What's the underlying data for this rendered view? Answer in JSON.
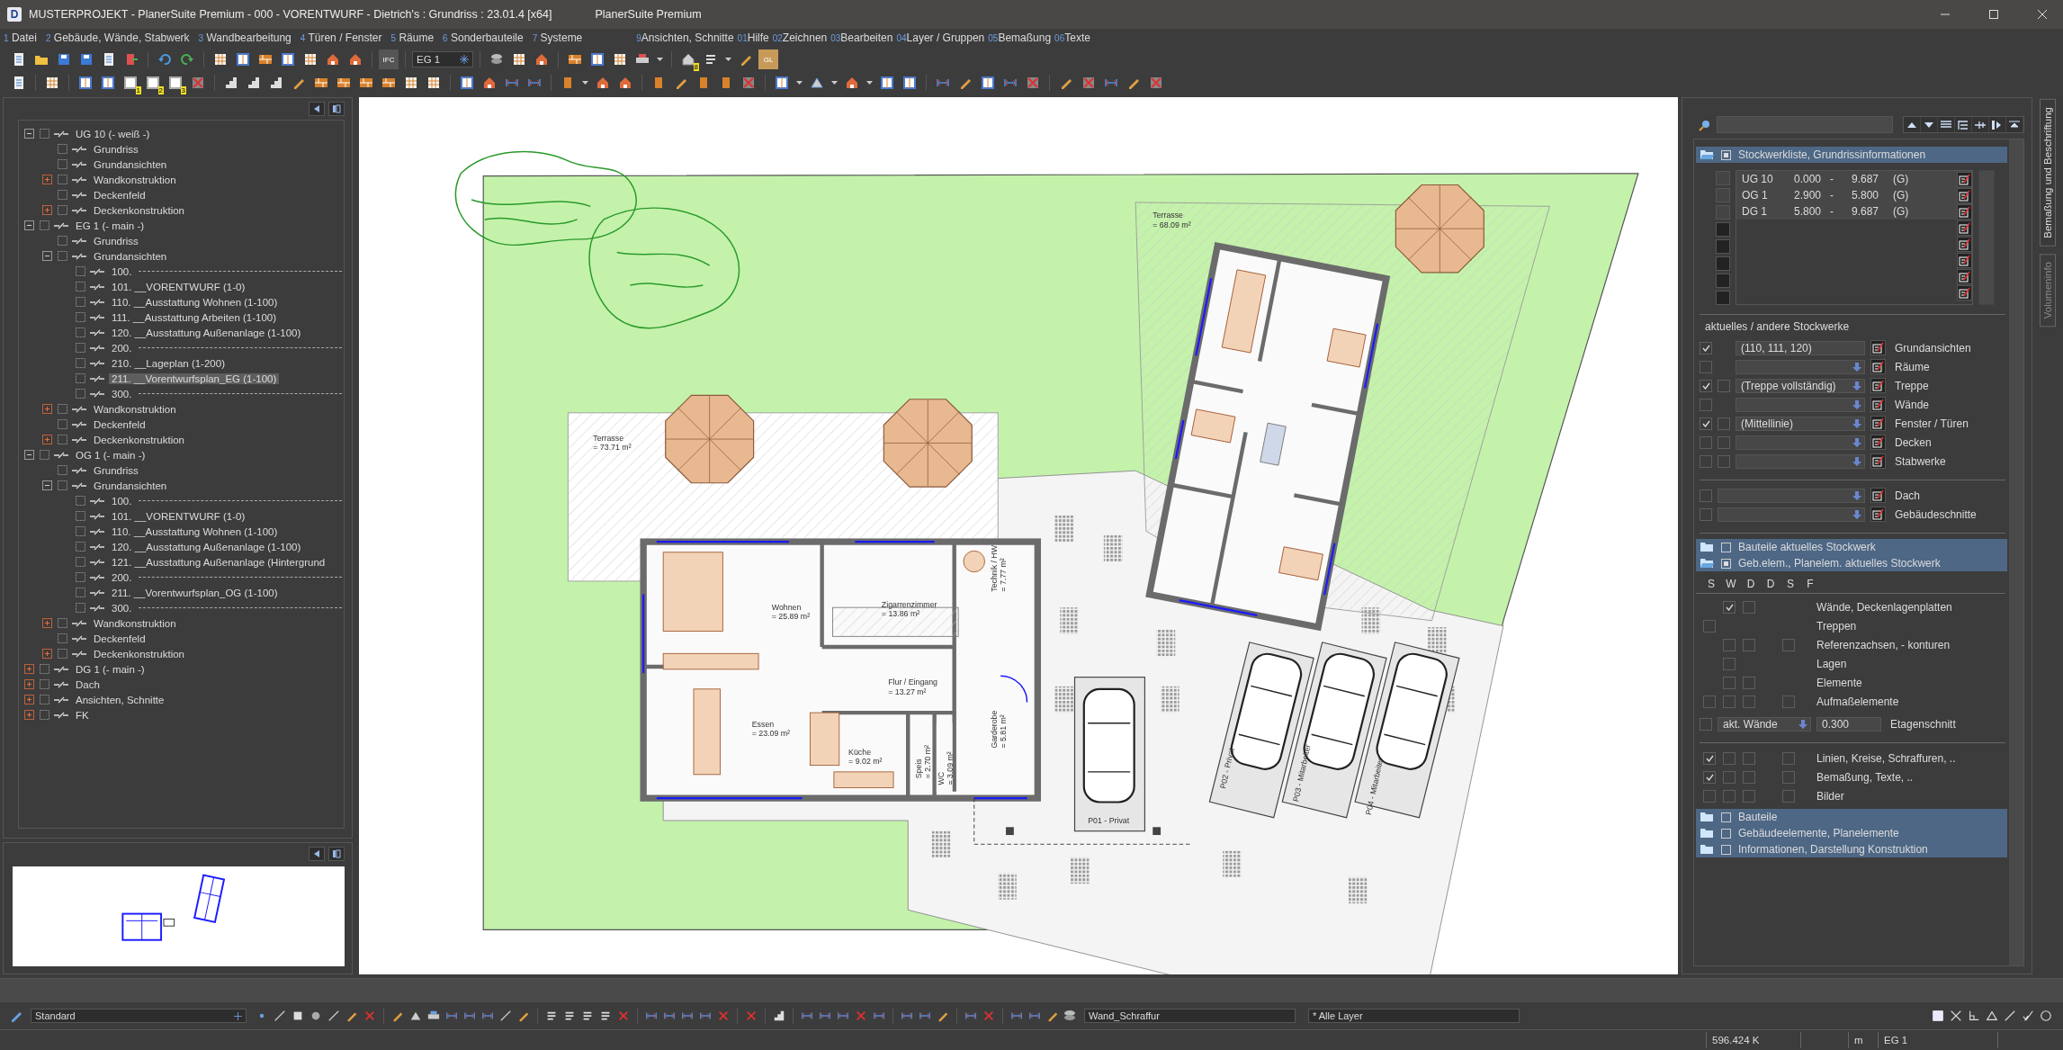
{
  "window": {
    "logo_letter": "D",
    "title": "MUSTERPROJEKT - PlanerSuite Premium - 000 - VORENTWURF - Dietrich's : Grundriss : 23.01.4 [x64]",
    "app_name": "PlanerSuite Premium"
  },
  "menu_left": [
    {
      "num": "1",
      "label": "Datei"
    },
    {
      "num": "2",
      "label": "Gebäude, Wände, Stabwerk"
    },
    {
      "num": "3",
      "label": "Wandbearbeitung"
    },
    {
      "num": "4",
      "label": "Türen / Fenster"
    },
    {
      "num": "5",
      "label": "Räume"
    },
    {
      "num": "6",
      "label": "Sonderbauteile"
    },
    {
      "num": "7",
      "label": "Systeme"
    }
  ],
  "menu_right": [
    {
      "num": "9",
      "label": "Ansichten, Schnitte"
    },
    {
      "num": "01",
      "label": "Hilfe"
    },
    {
      "num": "02",
      "label": "Zeichnen"
    },
    {
      "num": "03",
      "label": "Bearbeiten"
    },
    {
      "num": "04",
      "label": "Layer / Gruppen"
    },
    {
      "num": "05",
      "label": "Bemaßung"
    },
    {
      "num": "06",
      "label": "Texte"
    }
  ],
  "toolbars": {
    "floor_select": "EG 1",
    "ifc_label": "IFC",
    "gl_label": "GL",
    "badge": "8",
    "tool_badges": [
      "1",
      "2",
      "3"
    ]
  },
  "layer_tree": [
    {
      "label": "UG 10 (- weiß -)",
      "kind": "group",
      "expanded": true,
      "selected": false,
      "children": [
        {
          "label": "Grundriss",
          "kind": "leaf",
          "selected": false
        },
        {
          "label": "Grundansichten",
          "kind": "leaf",
          "selected": false
        },
        {
          "label": "Wandkonstruktion",
          "kind": "group",
          "expanded": false,
          "selected": false
        },
        {
          "label": "Deckenfeld",
          "kind": "leaf",
          "selected": false
        },
        {
          "label": "Deckenkonstruktion",
          "kind": "group",
          "expanded": false,
          "selected": false
        }
      ]
    },
    {
      "label": "EG 1 (- main -)",
      "kind": "group",
      "expanded": true,
      "selected": false,
      "children": [
        {
          "label": "Grundriss",
          "kind": "leaf",
          "selected": false
        },
        {
          "label": "Grundansichten",
          "kind": "group",
          "expanded": true,
          "selected": false,
          "children": [
            {
              "label": "100.",
              "kind": "separator",
              "selected": false
            },
            {
              "label": "101. __VORENTWURF (1-0)",
              "kind": "leaf",
              "selected": false
            },
            {
              "label": "110. __Ausstattung Wohnen (1-100)",
              "kind": "leaf",
              "selected": false
            },
            {
              "label": "111. __Ausstattung Arbeiten (1-100)",
              "kind": "leaf",
              "selected": false
            },
            {
              "label": "120. __Ausstattung Außenanlage (1-100)",
              "kind": "leaf",
              "selected": false
            },
            {
              "label": "200.",
              "kind": "separator",
              "selected": false
            },
            {
              "label": "210. __Lageplan (1-200)",
              "kind": "leaf",
              "selected": false
            },
            {
              "label": "211. __Vorentwurfsplan_EG (1-100)",
              "kind": "leaf",
              "selected": true
            },
            {
              "label": "300.",
              "kind": "separator",
              "selected": false
            }
          ]
        },
        {
          "label": "Wandkonstruktion",
          "kind": "group",
          "expanded": false,
          "selected": false
        },
        {
          "label": "Deckenfeld",
          "kind": "leaf",
          "selected": false
        },
        {
          "label": "Deckenkonstruktion",
          "kind": "group",
          "expanded": false,
          "selected": false
        }
      ]
    },
    {
      "label": "OG 1 (- main -)",
      "kind": "group",
      "expanded": true,
      "selected": false,
      "children": [
        {
          "label": "Grundriss",
          "kind": "leaf",
          "selected": false
        },
        {
          "label": "Grundansichten",
          "kind": "group",
          "expanded": true,
          "selected": false,
          "children": [
            {
              "label": "100.",
              "kind": "separator",
              "selected": false
            },
            {
              "label": "101. __VORENTWURF (1-0)",
              "kind": "leaf",
              "selected": false
            },
            {
              "label": "110. __Ausstattung Wohnen (1-100)",
              "kind": "leaf",
              "selected": false
            },
            {
              "label": "120. __Ausstattung Außenanlage (1-100)",
              "kind": "leaf",
              "selected": false
            },
            {
              "label": "121. __Ausstattung Außenanlage (Hintergrund",
              "kind": "leaf",
              "selected": false
            },
            {
              "label": "200.",
              "kind": "separator",
              "selected": false
            },
            {
              "label": "211. __Vorentwurfsplan_OG (1-100)",
              "kind": "leaf",
              "selected": false
            },
            {
              "label": "300.",
              "kind": "separator",
              "selected": false
            }
          ]
        },
        {
          "label": "Wandkonstruktion",
          "kind": "group",
          "expanded": false,
          "selected": false
        },
        {
          "label": "Deckenfeld",
          "kind": "leaf",
          "selected": false
        },
        {
          "label": "Deckenkonstruktion",
          "kind": "group",
          "expanded": false,
          "selected": false
        }
      ]
    },
    {
      "label": "DG 1 (- main -)",
      "kind": "group",
      "expanded": false,
      "selected": false
    },
    {
      "label": "Dach",
      "kind": "group",
      "expanded": false,
      "selected": false
    },
    {
      "label": "Ansichten, Schnitte",
      "kind": "group",
      "expanded": false,
      "selected": false
    },
    {
      "label": "FK",
      "kind": "group",
      "expanded": false,
      "selected": false
    }
  ],
  "plan": {
    "labels": [
      {
        "name": "Terrasse",
        "area": "= 73.71 m²"
      },
      {
        "name": "Wohnen",
        "area": "= 25.89 m²"
      },
      {
        "name": "Zigarrenzimmer",
        "area": "= 13.86 m²"
      },
      {
        "name": "Technik / HW",
        "area": "= 7.77 m²"
      },
      {
        "name": "Flur / Eingang",
        "area": "= 13.27 m²"
      },
      {
        "name": "Essen",
        "area": "= 23.09 m²"
      },
      {
        "name": "Küche",
        "area": "= 9.02 m²"
      },
      {
        "name": "Speis",
        "area": "= 2.70 m²"
      },
      {
        "name": "WC",
        "area": "= 3.09 m²"
      },
      {
        "name": "Garderobe",
        "area": "= 5.81 m²"
      },
      {
        "name": "Terrasse",
        "area": "= 68.09 m²"
      }
    ],
    "parking": [
      "P01 - Privat",
      "P02 - Privat",
      "P03 - Mitarbeiter",
      "P04 - Mitarbeiter"
    ]
  },
  "floor_list": {
    "label": "Stockwerkliste, Grundrissinformationen",
    "open": true,
    "checked": true,
    "floors": [
      {
        "name": "UG 10",
        "from": "0.000",
        "dash": "-",
        "to": "9.687",
        "flag": "(G)",
        "checked": false
      },
      {
        "name": "OG 1",
        "from": "2.900",
        "dash": "-",
        "to": "5.800",
        "flag": "(G)",
        "checked": false
      },
      {
        "name": "DG 1",
        "from": "5.800",
        "dash": "-",
        "to": "9.687",
        "flag": "(G)",
        "checked": false
      }
    ]
  },
  "other_floors": {
    "title": "aktuelles / andere Stockwerke",
    "rows": [
      {
        "label": "Grundansichten",
        "kind": "narrow",
        "checked": true,
        "value": "(110, 111, 120)",
        "dropdown": false
      },
      {
        "label": "Räume",
        "kind": "narrow",
        "checked": false,
        "dropdown": true
      },
      {
        "label": "Treppe",
        "kind": "narrow",
        "checked": true,
        "second": false,
        "value": "(Treppe vollständig)",
        "dropdown": true
      },
      {
        "label": "Wände",
        "kind": "narrow",
        "checked": false,
        "dropdown": true
      },
      {
        "label": "Fenster / Türen",
        "kind": "narrow",
        "checked": true,
        "second": false,
        "value": "(Mittellinie)",
        "dropdown": true
      },
      {
        "label": "Decken",
        "kind": "narrow",
        "checked": false,
        "second": false,
        "dropdown": true
      },
      {
        "label": "Stabwerke",
        "kind": "narrow",
        "checked": false,
        "second": false,
        "dropdown": true
      },
      {
        "label": "Dach",
        "kind": "wide",
        "checked": false,
        "dropdown": true
      },
      {
        "label": "Gebäudeschnitte",
        "kind": "wide",
        "checked": false,
        "dropdown": true
      }
    ]
  },
  "element_headers": [
    {
      "label": "Bauteile aktuelles Stockwerk",
      "open": false,
      "checked": false
    },
    {
      "label": "Geb.elem., Planelem. aktuelles Stockwerk",
      "open": true,
      "checked": true
    }
  ],
  "columns": [
    "S",
    "W",
    "D",
    "D",
    "S",
    "F"
  ],
  "element_rows": [
    {
      "label": "Wände, Deckenlagenplatten",
      "cells": [
        null,
        true,
        false,
        null,
        null
      ]
    },
    {
      "label": "Treppen",
      "cells": [
        false,
        null,
        null,
        null,
        null
      ]
    },
    {
      "label": "Referenzachsen, - konturen",
      "cells": [
        null,
        false,
        false,
        null,
        false
      ]
    },
    {
      "label": "Lagen",
      "cells": [
        null,
        false,
        null,
        null,
        null
      ]
    },
    {
      "label": "Elemente",
      "cells": [
        null,
        false,
        false,
        null,
        null
      ]
    },
    {
      "label": "Aufmaßelemente",
      "cells": [
        false,
        false,
        false,
        null,
        false
      ]
    }
  ],
  "floor_cut": {
    "checked": false,
    "mode": "akt. Wände",
    "value": "0.300",
    "label": "Etagenschnitt"
  },
  "drawing_rows": [
    {
      "label": "Linien, Kreise, Schraffuren, ..",
      "cells": [
        true,
        false,
        false,
        null,
        false
      ]
    },
    {
      "label": "Bemaßung, Texte, ..",
      "cells": [
        true,
        false,
        false,
        null,
        false
      ]
    },
    {
      "label": "Bilder",
      "cells": [
        false,
        false,
        false,
        null,
        false
      ]
    }
  ],
  "bottom_headers": [
    {
      "label": "Bauteile",
      "open": false,
      "checked": false
    },
    {
      "label": "Gebäudeelemente, Planelemente",
      "open": false,
      "checked": false
    },
    {
      "label": "Informationen, Darstellung Konstruktion",
      "open": false,
      "checked": false
    }
  ],
  "side_tabs": [
    {
      "label": "Bemaßung und Beschriftung",
      "selected": true
    },
    {
      "label": "Volumeninfo",
      "selected": false
    }
  ],
  "bottom_toolbar": {
    "pen_style": "Standard",
    "hatch": "Wand_Schraffur",
    "layer": "* Alle Layer"
  },
  "status_bar": {
    "memory": "596.424 K",
    "unit": "m",
    "floor": "EG 1"
  }
}
